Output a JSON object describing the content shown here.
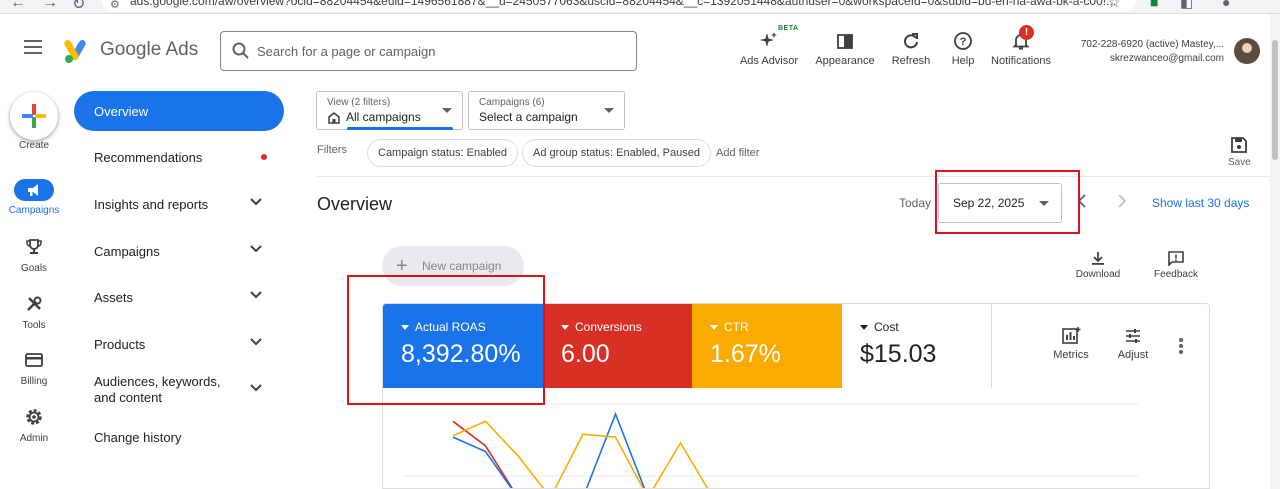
{
  "browser": {
    "url": "ads.google.com/aw/overview?ocid=88204454&euid=1496561887&__u=2450577063&uscid=88204454&__c=1392051448&authuser=0&workspaceId=0&subid=bd-en-ha-awa-bk-a-c00!..."
  },
  "header": {
    "brand": "Google Ads",
    "search_placeholder": "Search for a page or campaign",
    "tools": [
      {
        "label": "Ads Advisor",
        "badge": "BETA"
      },
      {
        "label": "Appearance"
      },
      {
        "label": "Refresh"
      },
      {
        "label": "Help"
      },
      {
        "label": "Notifications",
        "badge": "!"
      }
    ],
    "account_line1": "702-228-6920 (active) Mastey,...",
    "account_line2": "skrezwanceo@gmail.com"
  },
  "rail": {
    "items": [
      "Create",
      "Campaigns",
      "Goals",
      "Tools",
      "Billing",
      "Admin"
    ]
  },
  "nav": {
    "items": [
      "Overview",
      "Recommendations",
      "Insights and reports",
      "Campaigns",
      "Assets",
      "Products",
      "Audiences, keywords, and content",
      "Change history"
    ]
  },
  "main": {
    "view_selector": {
      "label": "View (2 filters)",
      "value": "All campaigns"
    },
    "campaign_selector": {
      "label": "Campaigns (6)",
      "value": "Select a campaign"
    },
    "filters_label": "Filters",
    "chips": [
      "Campaign status: Enabled",
      "Ad group status: Enabled, Paused"
    ],
    "add_filter": "Add filter",
    "save_label": "Save",
    "page_title": "Overview",
    "today_label": "Today",
    "date_value": "Sep 22, 2025",
    "show_last": "Show last 30 days",
    "new_campaign": "New campaign",
    "download_label": "Download",
    "feedback_label": "Feedback",
    "tiles": [
      {
        "label": "Actual ROAS",
        "value": "8,392.80%",
        "color": "#1a73e8"
      },
      {
        "label": "Conversions",
        "value": "6.00",
        "color": "#d93025"
      },
      {
        "label": "CTR",
        "value": "1.67%",
        "color": "#f9ab00"
      },
      {
        "label": "Cost",
        "value": "$15.03",
        "color": "#ffffff"
      }
    ],
    "metrics_label": "Metrics",
    "adjust_label": "Adjust"
  },
  "chart_data": {
    "type": "line",
    "x": [
      0,
      1,
      2,
      3,
      4,
      5,
      6,
      7,
      8
    ],
    "series": [
      {
        "values": [
          0.76,
          0.42,
          -0.3,
          null,
          null,
          null,
          null,
          null,
          null
        ],
        "color": "#d93025"
      },
      {
        "values": [
          0.54,
          0.34,
          -0.3,
          null,
          -0.3,
          0.86,
          -0.3,
          null,
          null
        ],
        "color": "#1a73e8"
      },
      {
        "values": [
          0.56,
          0.76,
          0.28,
          -0.3,
          0.58,
          0.54,
          -0.3,
          0.46,
          -0.3
        ],
        "color": "#f9ab00"
      }
    ],
    "ylim": [
      0,
      1
    ],
    "grid": true
  }
}
